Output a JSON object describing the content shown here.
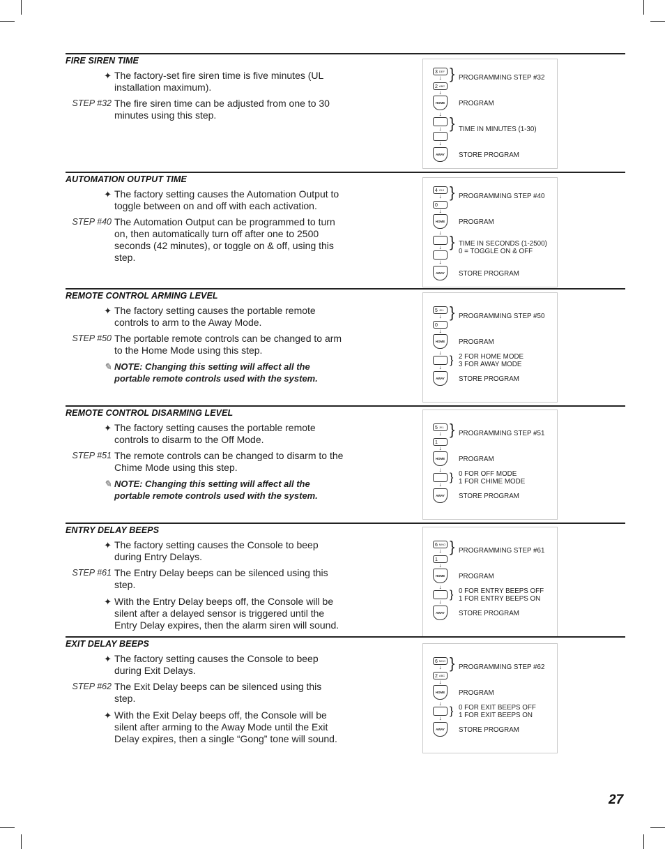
{
  "page_number": "27",
  "sections": [
    {
      "title": "FIRE SIREN TIME",
      "paragraphs": [
        {
          "marker": "✦",
          "type": "bullet",
          "text": "The factory-set fire siren time is five minutes (UL installation maximum)."
        },
        {
          "marker": "STEP #32",
          "type": "step",
          "text": "The fire siren time can be adjusted from one to 30 minutes using this step."
        }
      ],
      "diagram": {
        "keys": [
          {
            "num": "3",
            "sub": "DEF"
          },
          {
            "num": "2",
            "sub": "ABC"
          }
        ],
        "step_label": "PROGRAMMING STEP #32",
        "program_key": "HOME",
        "program_label": "PROGRAM",
        "entry_keys": 2,
        "entry_label": [
          "TIME IN MINUTES (1-30)"
        ],
        "store_key": "AWAY",
        "store_label": "STORE PROGRAM"
      }
    },
    {
      "title": "AUTOMATION OUTPUT TIME",
      "paragraphs": [
        {
          "marker": "✦",
          "type": "bullet",
          "text": "The factory setting causes the Automation Output to toggle between on and off with each activation."
        },
        {
          "marker": "STEP #40",
          "type": "step",
          "text": "The Automation Output can be programmed to turn on, then automatically turn off after one to 2500 seconds (42 minutes), or toggle on & off, using this step."
        }
      ],
      "diagram": {
        "keys": [
          {
            "num": "4",
            "sub": "GHI"
          },
          {
            "num": "0",
            "sub": ""
          }
        ],
        "step_label": "PROGRAMMING STEP #40",
        "program_key": "HOME",
        "program_label": "PROGRAM",
        "entry_keys": 2,
        "entry_label": [
          "TIME IN SECONDS (1-2500)",
          "0 = TOGGLE ON & OFF"
        ],
        "store_key": "AWAY",
        "store_label": "STORE PROGRAM"
      }
    },
    {
      "title": "REMOTE CONTROL ARMING LEVEL",
      "paragraphs": [
        {
          "marker": "✦",
          "type": "bullet",
          "text": "The factory setting causes the portable remote controls to arm to the Away Mode."
        },
        {
          "marker": "STEP #50",
          "type": "step",
          "text": "The portable remote controls can be changed to arm to the Home Mode using this step."
        },
        {
          "marker": "✎",
          "type": "note",
          "text": "NOTE: Changing this setting will affect all the portable remote controls used with the system."
        }
      ],
      "diagram": {
        "keys": [
          {
            "num": "5",
            "sub": "JKL"
          },
          {
            "num": "0",
            "sub": ""
          }
        ],
        "step_label": "PROGRAMMING STEP #50",
        "program_key": "HOME",
        "program_label": "PROGRAM",
        "entry_keys": 1,
        "entry_label": [
          "2 FOR HOME MODE",
          "3 FOR AWAY MODE"
        ],
        "store_key": "AWAY",
        "store_label": "STORE PROGRAM"
      }
    },
    {
      "title": "REMOTE CONTROL DISARMING LEVEL",
      "paragraphs": [
        {
          "marker": "✦",
          "type": "bullet",
          "text": "The factory setting causes the portable remote controls to disarm to the Off Mode."
        },
        {
          "marker": "STEP #51",
          "type": "step",
          "text": "The remote controls can be changed to disarm to the Chime Mode using this step."
        },
        {
          "marker": "✎",
          "type": "note",
          "text": "NOTE: Changing this setting will affect all the portable remote controls used with the system."
        }
      ],
      "diagram": {
        "keys": [
          {
            "num": "5",
            "sub": "JKL"
          },
          {
            "num": "1",
            "sub": ""
          }
        ],
        "step_label": "PROGRAMMING STEP #51",
        "program_key": "HOME",
        "program_label": "PROGRAM",
        "entry_keys": 1,
        "entry_label": [
          "0 FOR OFF MODE",
          "1 FOR CHIME MODE"
        ],
        "store_key": "AWAY",
        "store_label": "STORE PROGRAM"
      }
    },
    {
      "title": "ENTRY DELAY BEEPS",
      "paragraphs": [
        {
          "marker": "✦",
          "type": "bullet",
          "text": "The factory setting causes the Console to beep during Entry Delays."
        },
        {
          "marker": "STEP #61",
          "type": "step",
          "text": "The Entry Delay beeps can be silenced using this step."
        },
        {
          "marker": "✦",
          "type": "bullet",
          "text": "With the Entry Delay beeps off, the Console will be silent after a delayed sensor is triggered until the Entry Delay expires, then the alarm siren will sound."
        }
      ],
      "diagram": {
        "keys": [
          {
            "num": "6",
            "sub": "MNO"
          },
          {
            "num": "1",
            "sub": ""
          }
        ],
        "step_label": "PROGRAMMING STEP #61",
        "program_key": "HOME",
        "program_label": "PROGRAM",
        "entry_keys": 1,
        "entry_label": [
          "0 FOR ENTRY BEEPS OFF",
          "1 FOR ENTRY BEEPS ON"
        ],
        "store_key": "AWAY",
        "store_label": "STORE PROGRAM"
      }
    },
    {
      "title": "EXIT DELAY BEEPS",
      "paragraphs": [
        {
          "marker": "✦",
          "type": "bullet",
          "text": "The factory setting causes the Console to beep during Exit Delays."
        },
        {
          "marker": "STEP #62",
          "type": "step",
          "text": "The Exit Delay beeps can be silenced using this step."
        },
        {
          "marker": "✦",
          "type": "bullet",
          "text": "With the Exit Delay beeps off, the Console will be silent after arming to the Away Mode until the Exit Delay expires, then a single “Gong” tone will sound."
        }
      ],
      "diagram": {
        "keys": [
          {
            "num": "6",
            "sub": "MNO"
          },
          {
            "num": "2",
            "sub": "ABC"
          }
        ],
        "step_label": "PROGRAMMING STEP #62",
        "program_key": "HOME",
        "program_label": "PROGRAM",
        "entry_keys": 1,
        "entry_label": [
          "0 FOR EXIT BEEPS OFF",
          "1 FOR EXIT BEEPS ON"
        ],
        "store_key": "AWAY",
        "store_label": "STORE PROGRAM"
      }
    }
  ]
}
